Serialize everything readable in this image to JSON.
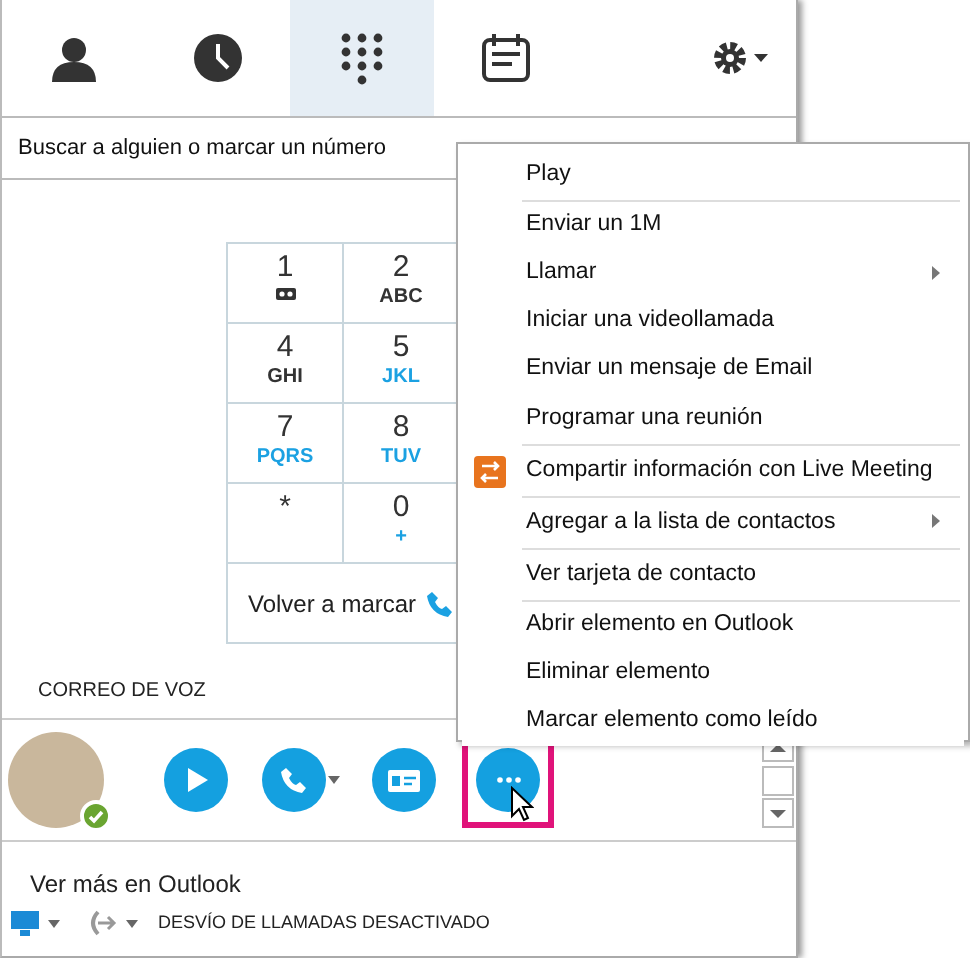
{
  "tabs": [
    {
      "kind": "contacts",
      "selected": false
    },
    {
      "kind": "history",
      "selected": false
    },
    {
      "kind": "dialpad",
      "selected": true
    },
    {
      "kind": "meetings",
      "selected": false
    }
  ],
  "search": {
    "placeholder": "Buscar a alguien o marcar un número"
  },
  "dialpad": {
    "keys": [
      {
        "digit": "1",
        "kind": "voicemail"
      },
      {
        "digit": "2",
        "letters": "ABC",
        "highlighted": false
      },
      {
        "digit": "4",
        "letters": "GHI",
        "highlighted": false
      },
      {
        "digit": "5",
        "letters": "JKL",
        "highlighted": true
      },
      {
        "digit": "7",
        "letters": "PQRS",
        "highlighted": true
      },
      {
        "digit": "8",
        "letters": "TUV",
        "highlighted": true
      },
      {
        "digit": "*"
      },
      {
        "digit": "0",
        "letters": "+",
        "highlighted": true
      }
    ],
    "redial": "Volver a marcar"
  },
  "voicemail_label": "CORREO DE VOZ",
  "actions": [
    {
      "kind": "play",
      "caret": false,
      "highlighted": false
    },
    {
      "kind": "call",
      "caret": true,
      "highlighted": false
    },
    {
      "kind": "card",
      "caret": false,
      "highlighted": false
    },
    {
      "kind": "more",
      "caret": false,
      "highlighted": true
    }
  ],
  "outlook_link": "Ver más en Outlook",
  "status_bar": {
    "forwarding": "DESVÍO DE LLAMADAS DESACTIVADO"
  },
  "context_menu": [
    {
      "label": "Play",
      "submenu": false,
      "separator_after": true
    },
    {
      "label": "Enviar un 1M",
      "submenu": false,
      "separator_after": false
    },
    {
      "label": "Llamar",
      "submenu": true,
      "separator_after": false
    },
    {
      "label": "Iniciar una videollamada",
      "submenu": false,
      "separator_after": false
    },
    {
      "label": "Enviar un mensaje de Email",
      "submenu": false,
      "separator_after": false
    },
    {
      "label": "Programar una reunión",
      "submenu": false,
      "separator_after": true
    },
    {
      "label": "Compartir información con Live Meeting",
      "submenu": false,
      "separator_after": true,
      "kind": "live-meeting"
    },
    {
      "label": "Agregar a la lista de contactos",
      "submenu": true,
      "separator_after": true
    },
    {
      "label": "Ver tarjeta de contacto",
      "submenu": false,
      "separator_after": true
    },
    {
      "label": "Abrir elemento en Outlook",
      "submenu": false,
      "separator_after": false
    },
    {
      "label": "Eliminar elemento",
      "submenu": false,
      "separator_after": false
    },
    {
      "label": "Marcar elemento como leído",
      "submenu": false,
      "separator_after": false
    }
  ]
}
